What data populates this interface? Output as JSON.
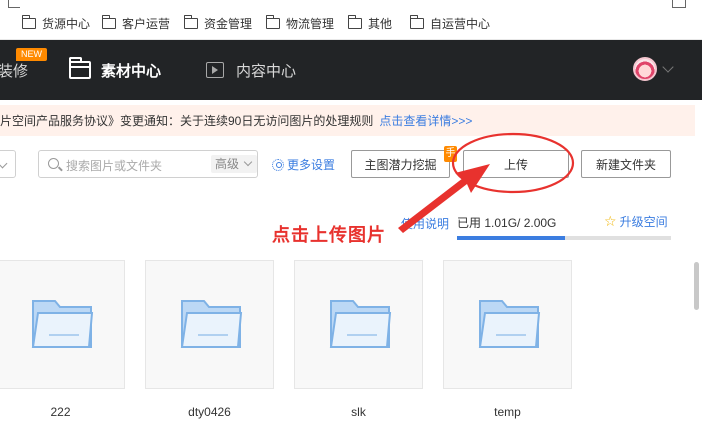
{
  "bookmarks": [
    {
      "label": "货源中心"
    },
    {
      "label": "客户运营"
    },
    {
      "label": "资金管理"
    },
    {
      "label": "物流管理"
    },
    {
      "label": "其他"
    },
    {
      "label": "自运营中心"
    }
  ],
  "nav": {
    "partial_item": "装修",
    "new_badge": "NEW",
    "active_item": "素材中心",
    "content_item": "内容中心"
  },
  "notice": {
    "text": "片空间产品服务协议》变更通知：关于连续90日无访问图片的处理规则",
    "link": "点击查看详情>>>"
  },
  "toolbar": {
    "search_placeholder": "搜索图片或文件夹",
    "advanced": "高级",
    "more_settings": "更多设置",
    "potential_button": "主图潜力挖掘",
    "hot_tag": "手",
    "upload_button": "上传",
    "new_folder_button": "新建文件夹"
  },
  "quota": {
    "help": "使用说明",
    "usage": "已用 1.01G/ 2.00G",
    "used_fraction": 0.505,
    "upgrade": "升级空间"
  },
  "annotation": {
    "hint": "点击上传图片",
    "color": "#e8322e"
  },
  "folders": [
    {
      "name": "222"
    },
    {
      "name": "dty0426"
    },
    {
      "name": "slk"
    },
    {
      "name": "temp"
    }
  ]
}
